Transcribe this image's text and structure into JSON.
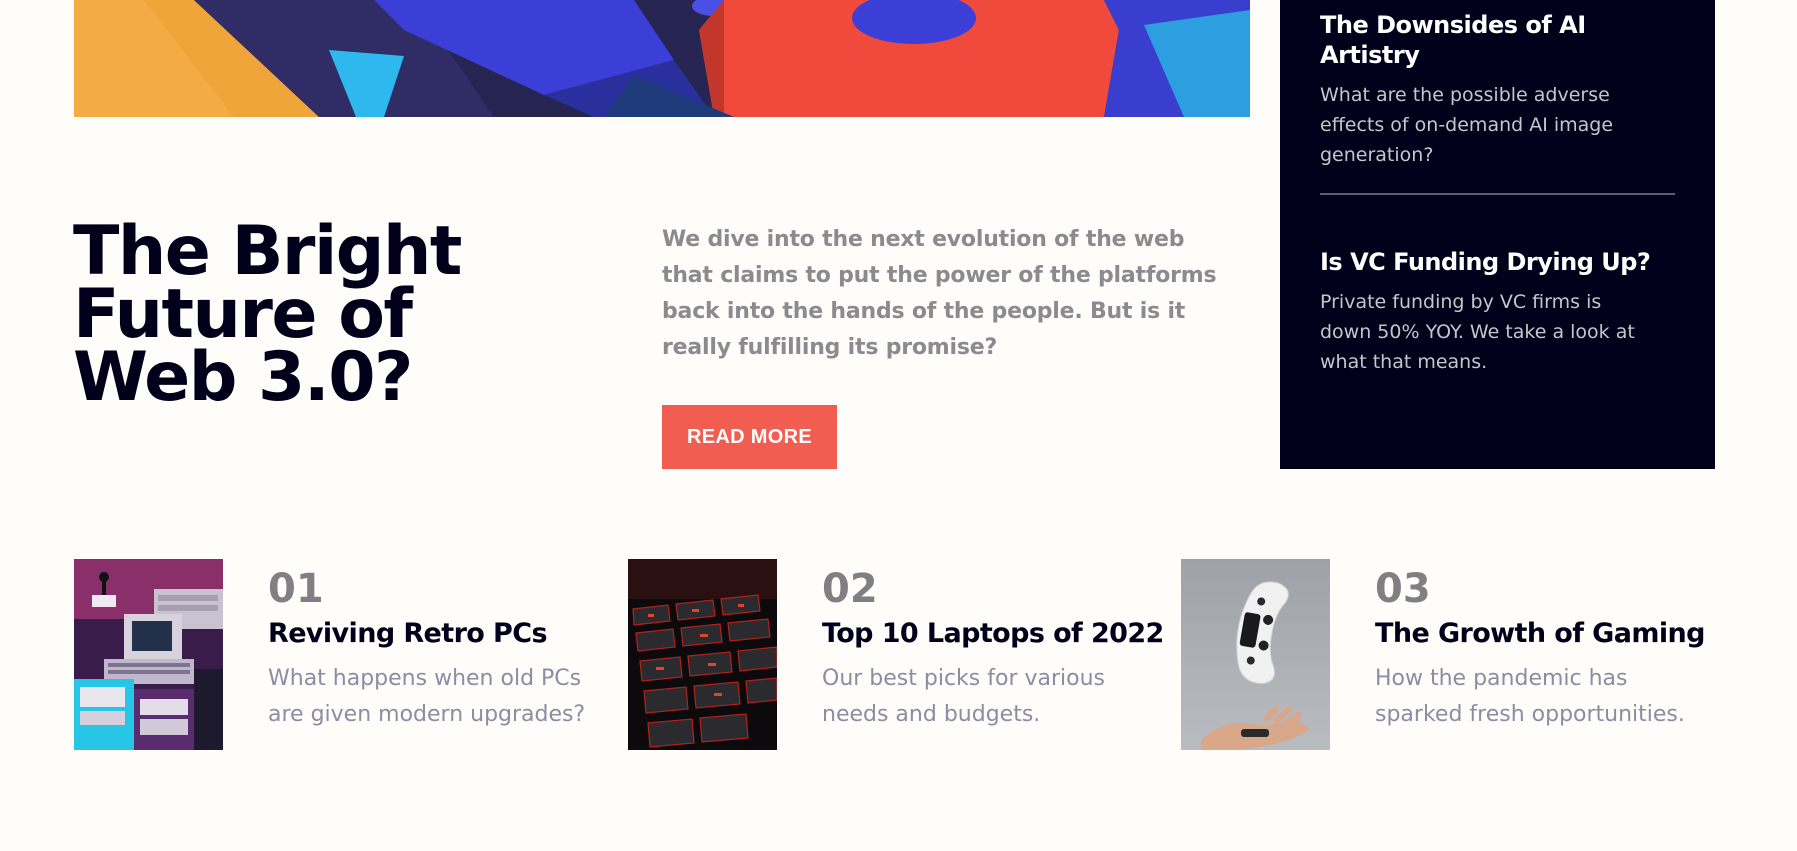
{
  "hero": {
    "headline": "The Bright Future of Web 3.0?",
    "intro": "We dive into the next evolution of the web that claims to put the power of the platforms back into the hands of the people. But is it really fulfilling its promise?",
    "cta_label": "READ MORE"
  },
  "sidebar": {
    "articles": [
      {
        "title": "The Downsides of AI Artistry",
        "description": "What are the possible adverse effects of on-demand AI image generation?"
      },
      {
        "title": "Is VC Funding Drying Up?",
        "description": "Private funding by VC firms is down 50% YOY. We take a look at what that means."
      }
    ]
  },
  "articles": [
    {
      "number": "01",
      "title": "Reviving Retro PCs",
      "description": "What happens when old PCs are given modern upgrades?",
      "image": "retro-pc-thumbnail"
    },
    {
      "number": "02",
      "title": "Top 10 Laptops of 2022",
      "description": "Our best picks for various needs and budgets.",
      "image": "laptop-keyboard-thumbnail"
    },
    {
      "number": "03",
      "title": "The Growth of Gaming",
      "description": "How the pandemic has sparked fresh opportunities.",
      "image": "game-controller-thumbnail"
    }
  ],
  "colors": {
    "background": "#fffdf9",
    "accent": "#f15d51",
    "dark": "#00001a",
    "muted": "#8a8da3"
  }
}
